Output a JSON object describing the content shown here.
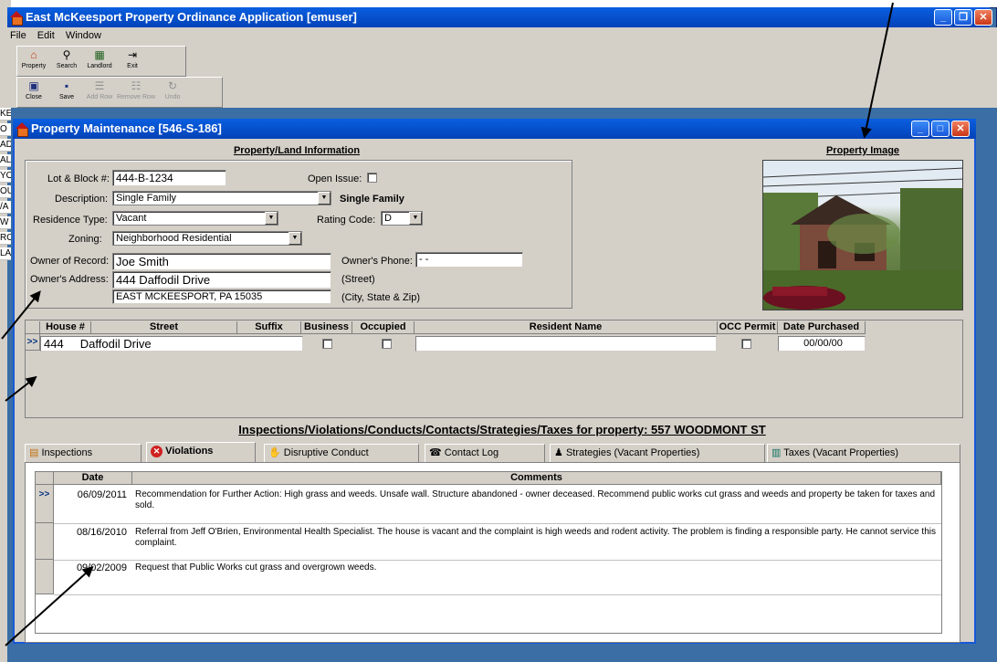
{
  "left_strip_items": [
    "KE",
    "O",
    "AD",
    "AL",
    "YO",
    "OU",
    "/A",
    "W",
    "RO",
    "LA"
  ],
  "outer_window": {
    "title": "East McKeesport Property Ordinance Application [emuser]"
  },
  "menu": [
    "File",
    "Edit",
    "Window"
  ],
  "toolbar1": [
    {
      "label": "Property",
      "icon": "house-icon"
    },
    {
      "label": "Search",
      "icon": "search-icon"
    },
    {
      "label": "Landlord",
      "icon": "landlord-icon"
    },
    {
      "label": "Exit",
      "icon": "exit-icon"
    }
  ],
  "toolbar2": [
    {
      "label": "Close",
      "icon": "close-doc-icon",
      "enabled": true
    },
    {
      "label": "Save",
      "icon": "save-icon",
      "enabled": true
    },
    {
      "label": "Add Row",
      "icon": "add-row-icon",
      "enabled": false
    },
    {
      "label": "Remove Row",
      "icon": "remove-row-icon",
      "enabled": false
    },
    {
      "label": "Undo",
      "icon": "undo-icon",
      "enabled": false
    }
  ],
  "inner_window": {
    "title": "Property Maintenance [546-S-186]"
  },
  "property": {
    "section_title": "Property/Land Information",
    "lot_label": "Lot & Block #:",
    "lot_value": "444-B-1234",
    "open_issue_label": "Open Issue:",
    "description_label": "Description:",
    "description_value": "Single Family",
    "description_display": "Single Family",
    "residence_label": "Residence Type:",
    "residence_value": "Vacant",
    "rating_label": "Rating Code:",
    "rating_value": "D",
    "zoning_label": "Zoning:",
    "zoning_value": "Neighborhood Residential",
    "owner_label": "Owner of Record:",
    "owner_value": "Joe Smith",
    "phone_label": "Owner's Phone:",
    "phone_value": " -  - ",
    "address_label": "Owner's Address:",
    "address_street": "444 Daffodil Drive",
    "street_hint": "(Street)",
    "address_city": "EAST MCKEESPORT, PA  15035",
    "city_hint": "(City, State & Zip)"
  },
  "image_section": {
    "title": "Property Image"
  },
  "house_grid": {
    "headers": [
      "House #",
      "Street",
      "Suffix",
      "Business",
      "Occupied",
      "Resident Name",
      "OCC Permit",
      "Date Purchased"
    ],
    "row": {
      "selector": ">>",
      "house": "444",
      "street": "Daffodil Drive",
      "date": "00/00/00"
    }
  },
  "inspections_title": "Inspections/Violations/Conducts/Contacts/Strategies/Taxes for property:  557 WOODMONT ST",
  "tabs": [
    {
      "label": "Inspections",
      "icon": "inspection-icon"
    },
    {
      "label": "Violations",
      "icon": "violation-icon"
    },
    {
      "label": "Disruptive Conduct",
      "icon": "hand-icon"
    },
    {
      "label": "Contact Log",
      "icon": "phone-icon"
    },
    {
      "label": "Strategies (Vacant Properties)",
      "icon": "strategy-icon"
    },
    {
      "label": "Taxes (Vacant Properties)",
      "icon": "taxes-icon"
    }
  ],
  "violations": {
    "headers": [
      "Date",
      "Comments"
    ],
    "rows": [
      {
        "selector": ">>",
        "date": "06/09/2011",
        "comment": "Recommendation for Further Action: High grass and weeds.  Unsafe wall. Structure abandoned - owner deceased.  Recommend public works cut grass and weeds and property be taken for taxes and sold."
      },
      {
        "selector": "",
        "date": "08/16/2010",
        "comment": "Referral from Jeff O'Brien, Environmental Health Specialist.  The house is vacant and the complaint is high weeds and rodent activity.  The problem is finding a responsible party. He cannot service this complaint."
      },
      {
        "selector": "",
        "date": "09/02/2009",
        "comment": "Request that Public Works cut grass and overgrown weeds."
      }
    ]
  },
  "colors": {
    "titlebar": "#0a5fe0",
    "window_bg": "#d4d0c8",
    "desktop": "#3a6ea5"
  }
}
